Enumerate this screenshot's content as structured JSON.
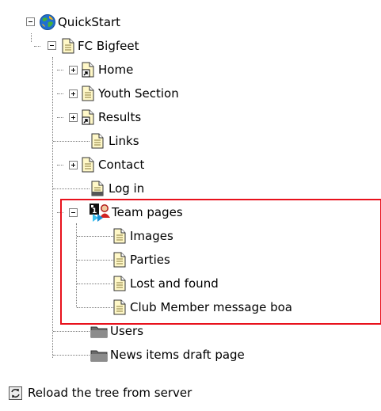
{
  "tree": {
    "root": {
      "label": "QuickStart",
      "icon": "globe-icon",
      "expanded": true
    },
    "site": {
      "label": "FC Bigfeet",
      "icon": "page-icon",
      "expanded": true
    },
    "items": [
      {
        "label": "Home",
        "icon": "page-shortcut-icon",
        "expander": "plus"
      },
      {
        "label": "Youth Section",
        "icon": "page-icon",
        "expander": "plus"
      },
      {
        "label": "Results",
        "icon": "page-shortcut-icon",
        "expander": "plus"
      },
      {
        "label": "Links",
        "icon": "page-icon",
        "expander": "none"
      },
      {
        "label": "Contact",
        "icon": "page-icon",
        "expander": "plus"
      },
      {
        "label": "Log in",
        "icon": "page-icon",
        "expander": "none"
      },
      {
        "label": "Team pages",
        "icon": "team-page-icon",
        "expander": "minus"
      }
    ],
    "team_children": [
      {
        "label": "Images",
        "icon": "page-icon"
      },
      {
        "label": "Parties",
        "icon": "page-icon"
      },
      {
        "label": "Lost and found",
        "icon": "page-icon"
      },
      {
        "label": "Club Member message boa",
        "icon": "page-icon"
      }
    ],
    "after_items": [
      {
        "label": "Users",
        "icon": "folder-icon"
      },
      {
        "label": "News items draft page",
        "icon": "folder-icon"
      }
    ]
  },
  "footer": {
    "reload_label": "Reload the tree from server",
    "icon": "reload-icon"
  },
  "colors": {
    "highlight_border": "#e8111c",
    "page_fill": "#fff8c8",
    "globe_blue": "#1f6fd1",
    "globe_green": "#45b23a"
  }
}
